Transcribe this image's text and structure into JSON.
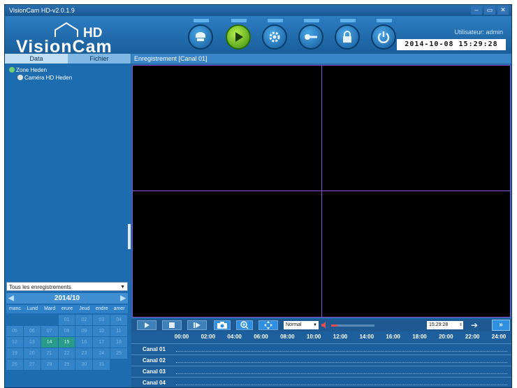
{
  "window": {
    "title": "VisionCam HD-v2.0.1.9",
    "minimize": "‒",
    "maximize": "▭",
    "close": "✕"
  },
  "logo": {
    "hd": "HD",
    "name": "VisionCam"
  },
  "toolbar": {
    "icons": [
      "camera-icon",
      "play-icon",
      "gear-icon",
      "key-icon",
      "lock-icon",
      "power-icon"
    ],
    "active": "play-icon"
  },
  "header": {
    "user_label": "Utilisateur: admin",
    "clock": "2014-10-08 15:29:28"
  },
  "sidebar": {
    "tabs": [
      "Data",
      "Fichier"
    ],
    "tree": [
      {
        "label": "Zone Heden"
      },
      {
        "label": "Caméra HD Heden"
      }
    ],
    "filter": "Tous les enregistrements"
  },
  "calendar": {
    "month": "2014/10",
    "prev": "◀",
    "next": "▶",
    "days": [
      "manc",
      "Lund",
      "Mard",
      "erure",
      "Jeud",
      "endre",
      "amer"
    ],
    "weeks": [
      [
        "",
        "",
        "",
        "01",
        "02",
        "03",
        "04"
      ],
      [
        "05",
        "06",
        "07",
        "08",
        "09",
        "10",
        "11"
      ],
      [
        "12",
        "13",
        "14",
        "15",
        "16",
        "17",
        "18"
      ],
      [
        "19",
        "20",
        "21",
        "22",
        "23",
        "24",
        "25"
      ],
      [
        "26",
        "27",
        "28",
        "29",
        "30",
        "31",
        ""
      ]
    ],
    "highlighted": [
      "14",
      "15"
    ]
  },
  "view": {
    "title": "Enregistrement [Canal 01]"
  },
  "controls": {
    "speed": "Normal",
    "volume_level": 0.15,
    "time": "15:29:28",
    "go": "➔",
    "expand": "»"
  },
  "timeline": {
    "hours": [
      "00:00",
      "02:00",
      "04:00",
      "06:00",
      "08:00",
      "10:00",
      "12:00",
      "14:00",
      "16:00",
      "18:00",
      "20:00",
      "22:00",
      "24:00"
    ],
    "channels": [
      "Canal 01",
      "Canal 02",
      "Canal 03",
      "Canal 04"
    ]
  }
}
